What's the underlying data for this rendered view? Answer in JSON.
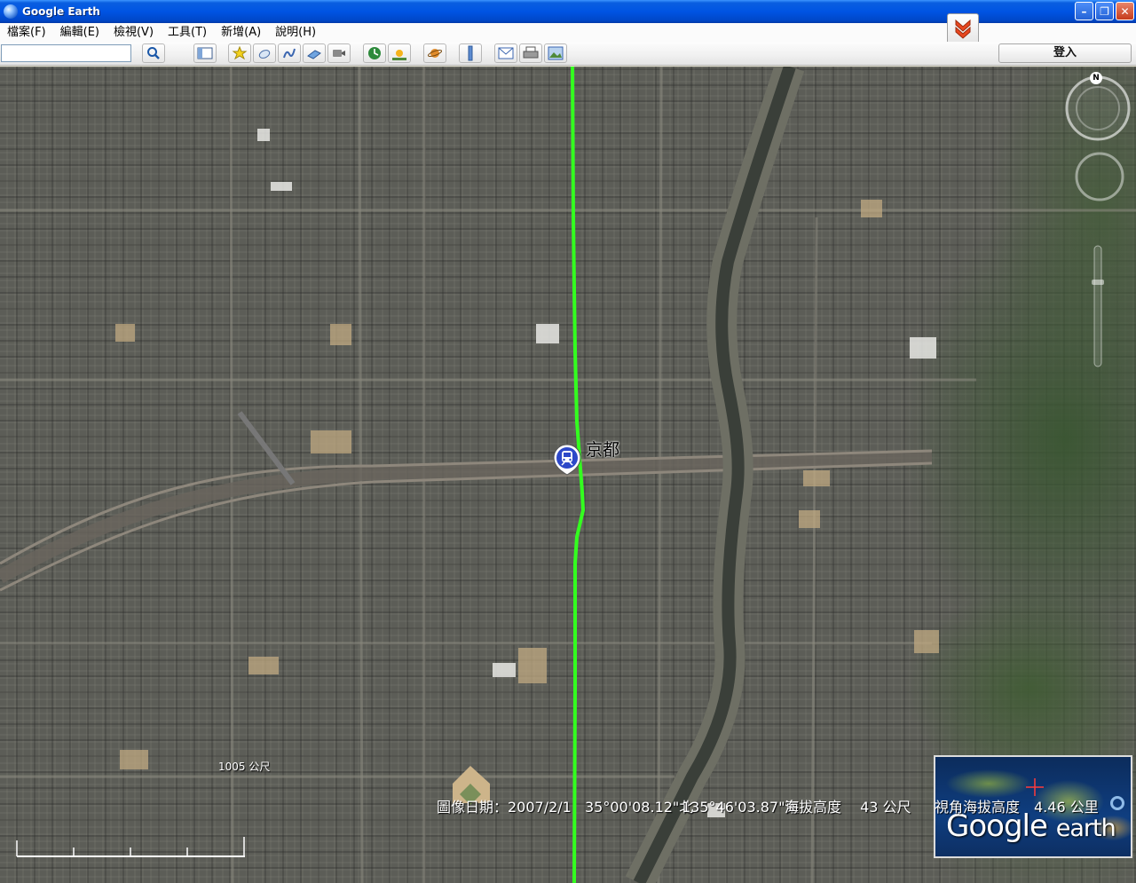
{
  "window": {
    "title": "Google Earth"
  },
  "menu": [
    {
      "label": "檔案(F)"
    },
    {
      "label": "編輯(E)"
    },
    {
      "label": "檢視(V)"
    },
    {
      "label": "工具(T)"
    },
    {
      "label": "新增(A)"
    },
    {
      "label": "說明(H)"
    }
  ],
  "toolbar": {
    "search_value": "",
    "sign_in_label": "登入",
    "icons": [
      "search-icon",
      "sidebar-icon",
      "placemark-icon",
      "polygon-icon",
      "path-icon",
      "image-overlay-icon",
      "record-tour-icon",
      "historical-imagery-icon",
      "sunlight-icon",
      "planets-icon",
      "ruler-icon",
      "email-icon",
      "print-icon",
      "save-image-icon"
    ]
  },
  "map": {
    "station_label": "京都",
    "scale_label": "1005 公尺",
    "route_color": "#33ff1f",
    "overview_logo_1": "Google",
    "overview_logo_2": "earth",
    "north_label": "N"
  },
  "status": {
    "imagery_date": "圖像日期：2007/2/1",
    "lat": "35°00'08.12\"北",
    "lon": "135°46'03.87\"東",
    "elevation": "海拔高度　 43 公尺",
    "eye_alt": "視角海拔高度　4.46 公里"
  }
}
